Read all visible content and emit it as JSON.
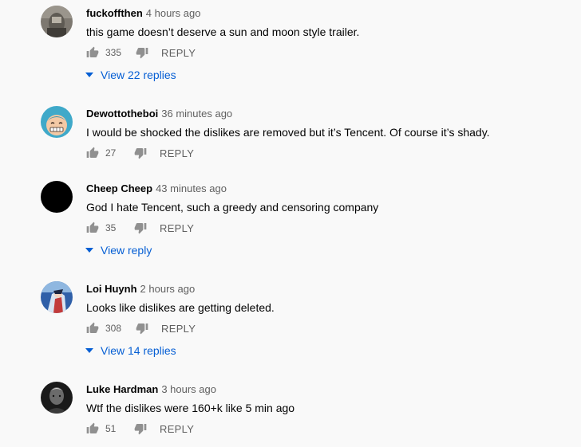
{
  "colors": {
    "background": "#f9f9f9",
    "text": "#030303",
    "secondary": "#606060",
    "link": "#065fd4"
  },
  "reply_label": "REPLY",
  "comments": [
    {
      "author": "fuckoffthen",
      "time": "4 hours ago",
      "text": "this game doesn’t deserve a sun and moon style trailer.",
      "likes": "335",
      "replies": "View 22 replies",
      "avatar": "monochrome-photo-avatar"
    },
    {
      "author": "Dewottotheboi",
      "time": "36 minutes ago",
      "text": "I would be shocked the dislikes are removed but it’s Tencent. Of course it’s shady.",
      "likes": "27",
      "avatar": "cartoon-character-avatar"
    },
    {
      "author": "Cheep Cheep",
      "time": "43 minutes ago",
      "text": "God I hate Tencent, such a greedy and censoring company",
      "likes": "35",
      "replies": "View reply",
      "avatar": "black-circle-avatar"
    },
    {
      "author": "Loi Huynh",
      "time": "2 hours ago",
      "text": "Looks like dislikes are getting deleted.",
      "likes": "308",
      "replies": "View 14 replies",
      "avatar": "anime-character-avatar"
    },
    {
      "author": "Luke Hardman",
      "time": "3 hours ago",
      "text": "Wtf the dislikes were 160+k like 5 min ago",
      "likes": "51",
      "avatar": "dark-portrait-avatar"
    }
  ]
}
